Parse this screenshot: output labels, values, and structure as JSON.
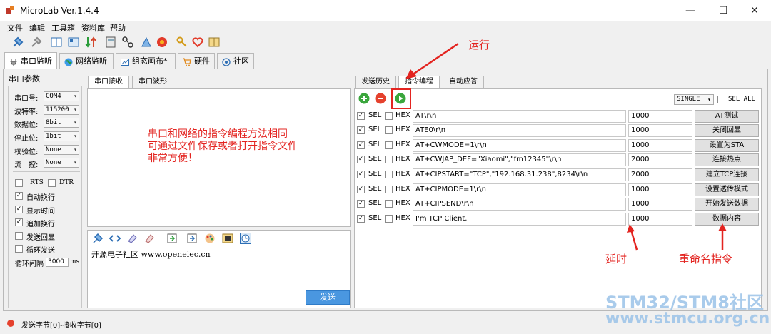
{
  "app": {
    "title": "MicroLab Ver.1.4.4"
  },
  "window_controls": {
    "minimize": "—",
    "maximize": "☐",
    "close": "✕"
  },
  "menu": [
    "文件",
    "编辑",
    "工具箱",
    "资料库",
    "帮助"
  ],
  "toolbar_icons": [
    "connect-icon",
    "disconnect-icon",
    "columns-icon",
    "layout-icon",
    "sort-icon",
    "calculator-icon",
    "network-icon",
    "chip-icon",
    "flame-icon",
    "key-icon",
    "heart-icon",
    "book-icon"
  ],
  "main_tabs": [
    {
      "label": "串口监听",
      "icon": "plug-icon"
    },
    {
      "label": "网络监听",
      "icon": "globe-icon"
    },
    {
      "label": "组态画布*",
      "icon": "canvas-icon"
    },
    {
      "label": "硬件",
      "icon": "cart-icon"
    },
    {
      "label": "社区",
      "icon": "community-icon"
    }
  ],
  "params": {
    "title": "串口参数",
    "rows": [
      {
        "label": "串口号:",
        "value": "COM4"
      },
      {
        "label": "波特率:",
        "value": "115200"
      },
      {
        "label": "数据位:",
        "value": "8bit"
      },
      {
        "label": "停止位:",
        "value": "1bit"
      },
      {
        "label": "校验位:",
        "value": "None"
      },
      {
        "label": "流　控:",
        "value": "None"
      }
    ],
    "rts": "RTS",
    "dtr": "DTR",
    "options": [
      {
        "label": "自动换行",
        "checked": true
      },
      {
        "label": "显示时间",
        "checked": true
      },
      {
        "label": "追加换行",
        "checked": true
      },
      {
        "label": "发送回显",
        "checked": false
      },
      {
        "label": "循环发送",
        "checked": false
      }
    ],
    "interval_label": "循环间隔",
    "interval_value": "3000",
    "interval_unit": "ms"
  },
  "receive": {
    "tabs": [
      "串口接收",
      "串口波形"
    ]
  },
  "send": {
    "text": "开源电子社区 www.openelec.cn",
    "button": "发送"
  },
  "annotations": {
    "run": "运行",
    "note_lines": [
      "串口和网络的指令编程方法相同",
      "可通过文件保存或者打开指令文件",
      "非常方便！"
    ],
    "delay": "延时",
    "rename": "重命名指令"
  },
  "right_tabs": [
    "发送历史",
    "指令编程",
    "自动应答"
  ],
  "command_panel": {
    "mode": "SINGLE",
    "sel_all": "SEL ALL",
    "sel": "SEL",
    "hex": "HEX",
    "rows": [
      {
        "cmd": "AT\\r\\n",
        "delay": "1000",
        "name": "AT测试"
      },
      {
        "cmd": "ATE0\\r\\n",
        "delay": "1000",
        "name": "关闭回显"
      },
      {
        "cmd": "AT+CWMODE=1\\r\\n",
        "delay": "1000",
        "name": "设置为STA"
      },
      {
        "cmd": "AT+CWJAP_DEF=\"Xiaomi\",\"fm12345\"\\r\\n",
        "delay": "2000",
        "name": "连接热点"
      },
      {
        "cmd": "AT+CIPSTART=\"TCP\",\"192.168.31.238\",8234\\r\\n",
        "delay": "2000",
        "name": "建立TCP连接"
      },
      {
        "cmd": "AT+CIPMODE=1\\r\\n",
        "delay": "1000",
        "name": "设置透传模式"
      },
      {
        "cmd": "AT+CIPSEND\\r\\n",
        "delay": "1000",
        "name": "开始发送数据"
      },
      {
        "cmd": "I'm TCP Client.",
        "delay": "1000",
        "name": "数据内容"
      }
    ]
  },
  "status": {
    "text": "发送字节[0]-接收字节[0]"
  },
  "watermark": {
    "line1": "STM32/STM8社区",
    "line2": "www.stmcu.org.cn"
  }
}
